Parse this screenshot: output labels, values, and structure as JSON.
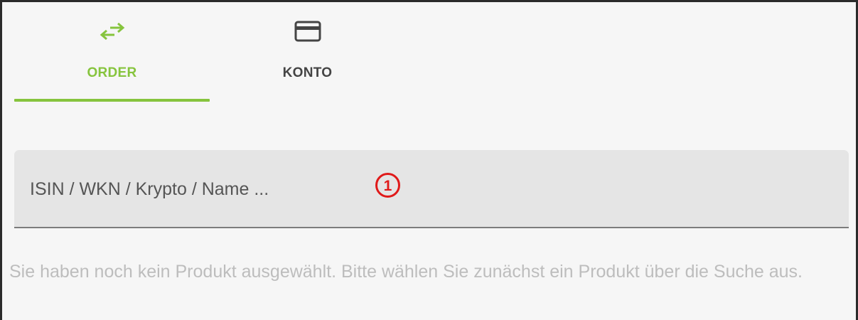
{
  "tabs": [
    {
      "label": "ORDER",
      "icon": "swap-arrows-icon",
      "active": true
    },
    {
      "label": "KONTO",
      "icon": "credit-card-icon",
      "active": false
    }
  ],
  "search": {
    "placeholder": "ISIN / WKN / Krypto / Name ...",
    "value": "",
    "marker": "1"
  },
  "hint": {
    "text": "Sie haben noch kein Produkt ausgewählt. Bitte wählen Sie zunächst ein Produkt über die Suche aus."
  },
  "colors": {
    "accent": "#86c43d",
    "annotation": "#e01a1a",
    "field_background": "#e5e5e5",
    "page_background": "#f6f6f6"
  }
}
